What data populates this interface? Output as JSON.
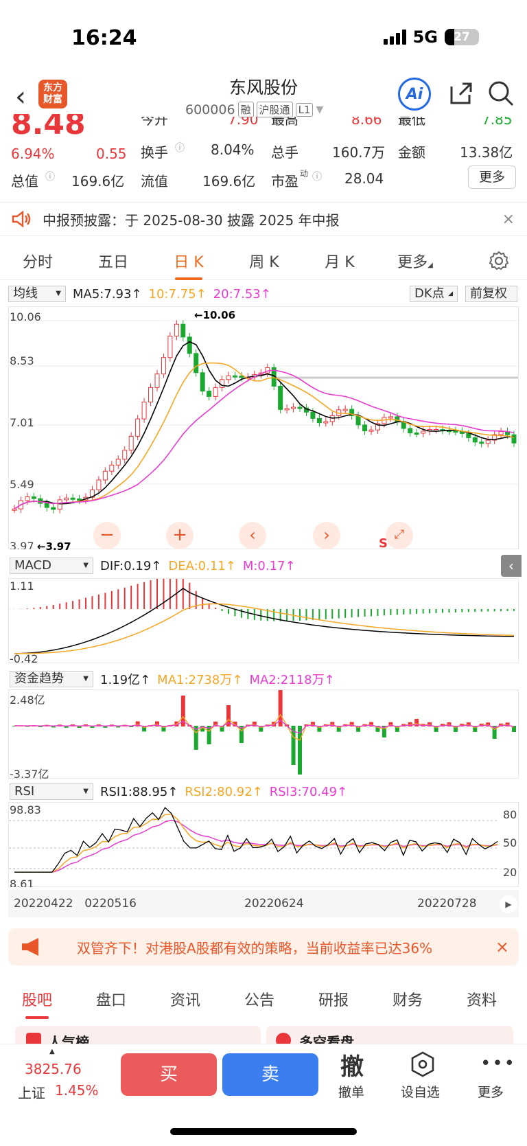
{
  "status": {
    "time": "16:24",
    "network": "5G",
    "battery": "27"
  },
  "header": {
    "logo": "东方\n财富",
    "title": "东风股份",
    "code": "600006",
    "tags": [
      "融",
      "沪股通",
      "L1"
    ],
    "ai": "Ai"
  },
  "quote": {
    "price": "8.48",
    "change_pct": "6.94%",
    "change": "0.55",
    "open_label": "今开",
    "open": "7.90",
    "high_label": "最高",
    "high": "8.66",
    "low_label": "最低",
    "low": "7.85",
    "turnover_label": "换手",
    "turnover": "8.04%",
    "volume_label": "总手",
    "volume": "160.7万",
    "amount_label": "金额",
    "amount": "13.38亿",
    "mktcap_label": "总值",
    "mktcap": "169.6亿",
    "float_label": "流值",
    "float": "169.6亿",
    "pe_label": "市盈",
    "pe_sup": "动",
    "pe": "28.04",
    "more": "更多"
  },
  "notice": {
    "text": "中报预披露：于 2025-08-30 披露 2025 年中报",
    "close": "×"
  },
  "ktabs": [
    "分时",
    "五日",
    "日 K",
    "周 K",
    "月 K",
    "更多"
  ],
  "kline": {
    "ma_select": "均线",
    "ma5": "MA5:7.93↑",
    "ma10": "10:7.75↑",
    "ma20": "20:7.53↑",
    "dk": "DK点",
    "fq": "前复权",
    "axis": [
      "10.06",
      "8.53",
      "7.01",
      "5.49",
      "3.97"
    ],
    "max_label": "←10.06",
    "min_label": "←3.97",
    "s_label": "S"
  },
  "macd": {
    "select": "MACD",
    "dif": "DIF:0.19↑",
    "dea": "DEA:0.11↑",
    "m": "M:0.17↑",
    "axis": [
      "1.11",
      "-0.42"
    ]
  },
  "fund": {
    "select": "资金趋势",
    "v": "1.19亿↑",
    "ma1": "MA1:2738万↑",
    "ma2": "MA2:2118万↑",
    "axis": [
      "2.48亿",
      "-3.37亿"
    ]
  },
  "rsi": {
    "select": "RSI",
    "rsi1": "RSI1:88.95↑",
    "rsi2": "RSI2:80.92↑",
    "rsi3": "RSI3:70.49↑",
    "axis": [
      "98.83",
      "8.61"
    ],
    "levels": [
      "80",
      "50",
      "20"
    ]
  },
  "dates": [
    "20220422",
    "20220516",
    "20220624",
    "20220728"
  ],
  "banner": {
    "text": "双管齐下！对港股A股都有效的策略，当前收益率已达36%",
    "close": "×"
  },
  "bottom_tabs": [
    "股吧",
    "盘口",
    "资讯",
    "公告",
    "研报",
    "财务",
    "资料"
  ],
  "peek": [
    "人气榜",
    "多空看盘"
  ],
  "bottom_bar": {
    "index_value": "3825.76",
    "index_name": "上证",
    "index_pct": "1.45%",
    "buy": "买",
    "sell": "卖",
    "cancel_glyph": "撤",
    "cancel": "撤单",
    "watch": "设自选",
    "more": "更多"
  },
  "colors": {
    "red": "#e8363a",
    "green": "#1aa830",
    "ma5": "#000000",
    "ma10": "#f6a623",
    "ma20": "#e83bd2",
    "accent": "#ee6a1e"
  }
}
